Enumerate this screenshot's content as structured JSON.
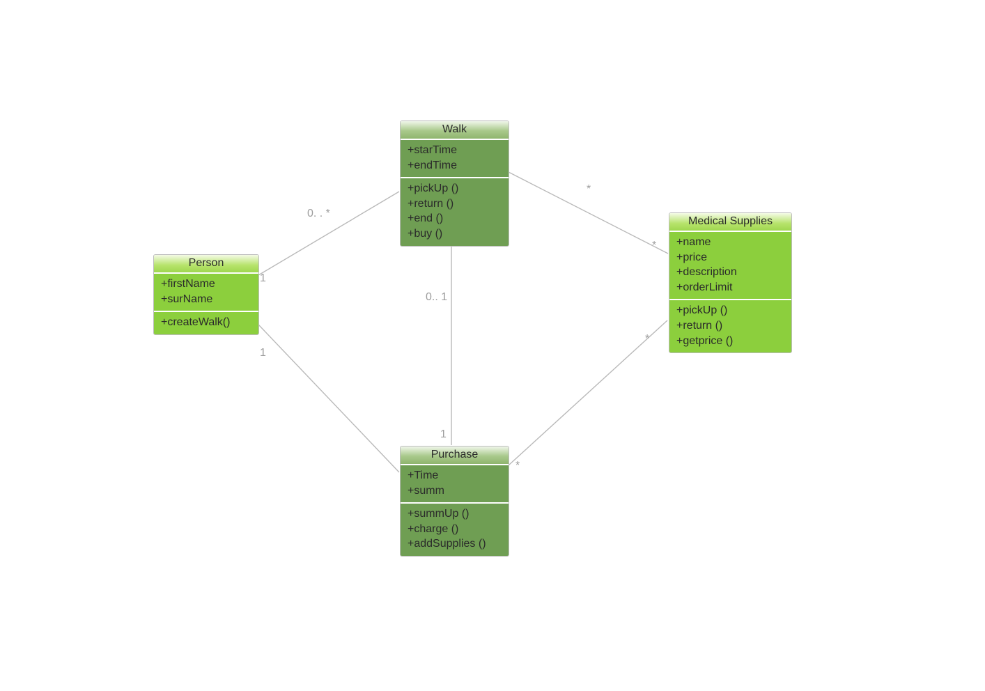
{
  "classes": {
    "person": {
      "title": "Person",
      "attributes": [
        "+firstName",
        "+surName"
      ],
      "methods": [
        "+createWalk()"
      ]
    },
    "walk": {
      "title": "Walk",
      "attributes": [
        "+starTime",
        "+endTime"
      ],
      "methods": [
        "+pickUp ()",
        "+return ()",
        "+end ()",
        "+buy ()"
      ]
    },
    "medicalSupplies": {
      "title": "Medical Supplies",
      "attributes": [
        "+name",
        "+price",
        "+description",
        "+orderLimit"
      ],
      "methods": [
        "+pickUp ()",
        "+return ()",
        "+getprice ()"
      ]
    },
    "purchase": {
      "title": "Purchase",
      "attributes": [
        "+Time",
        "+summ"
      ],
      "methods": [
        "+summUp ()",
        "+charge ()",
        "+addSupplies ()"
      ]
    }
  },
  "labels": {
    "personWalk_left": "1",
    "personWalk_right": "0. . *",
    "personPurchase_left": "1",
    "walkPurchase_top": "0.. 1",
    "walkPurchase_bottom": "1",
    "walkMed_left": "*",
    "walkMed_right": "*",
    "purchaseMed_left": "*",
    "purchaseMed_right": "*"
  }
}
